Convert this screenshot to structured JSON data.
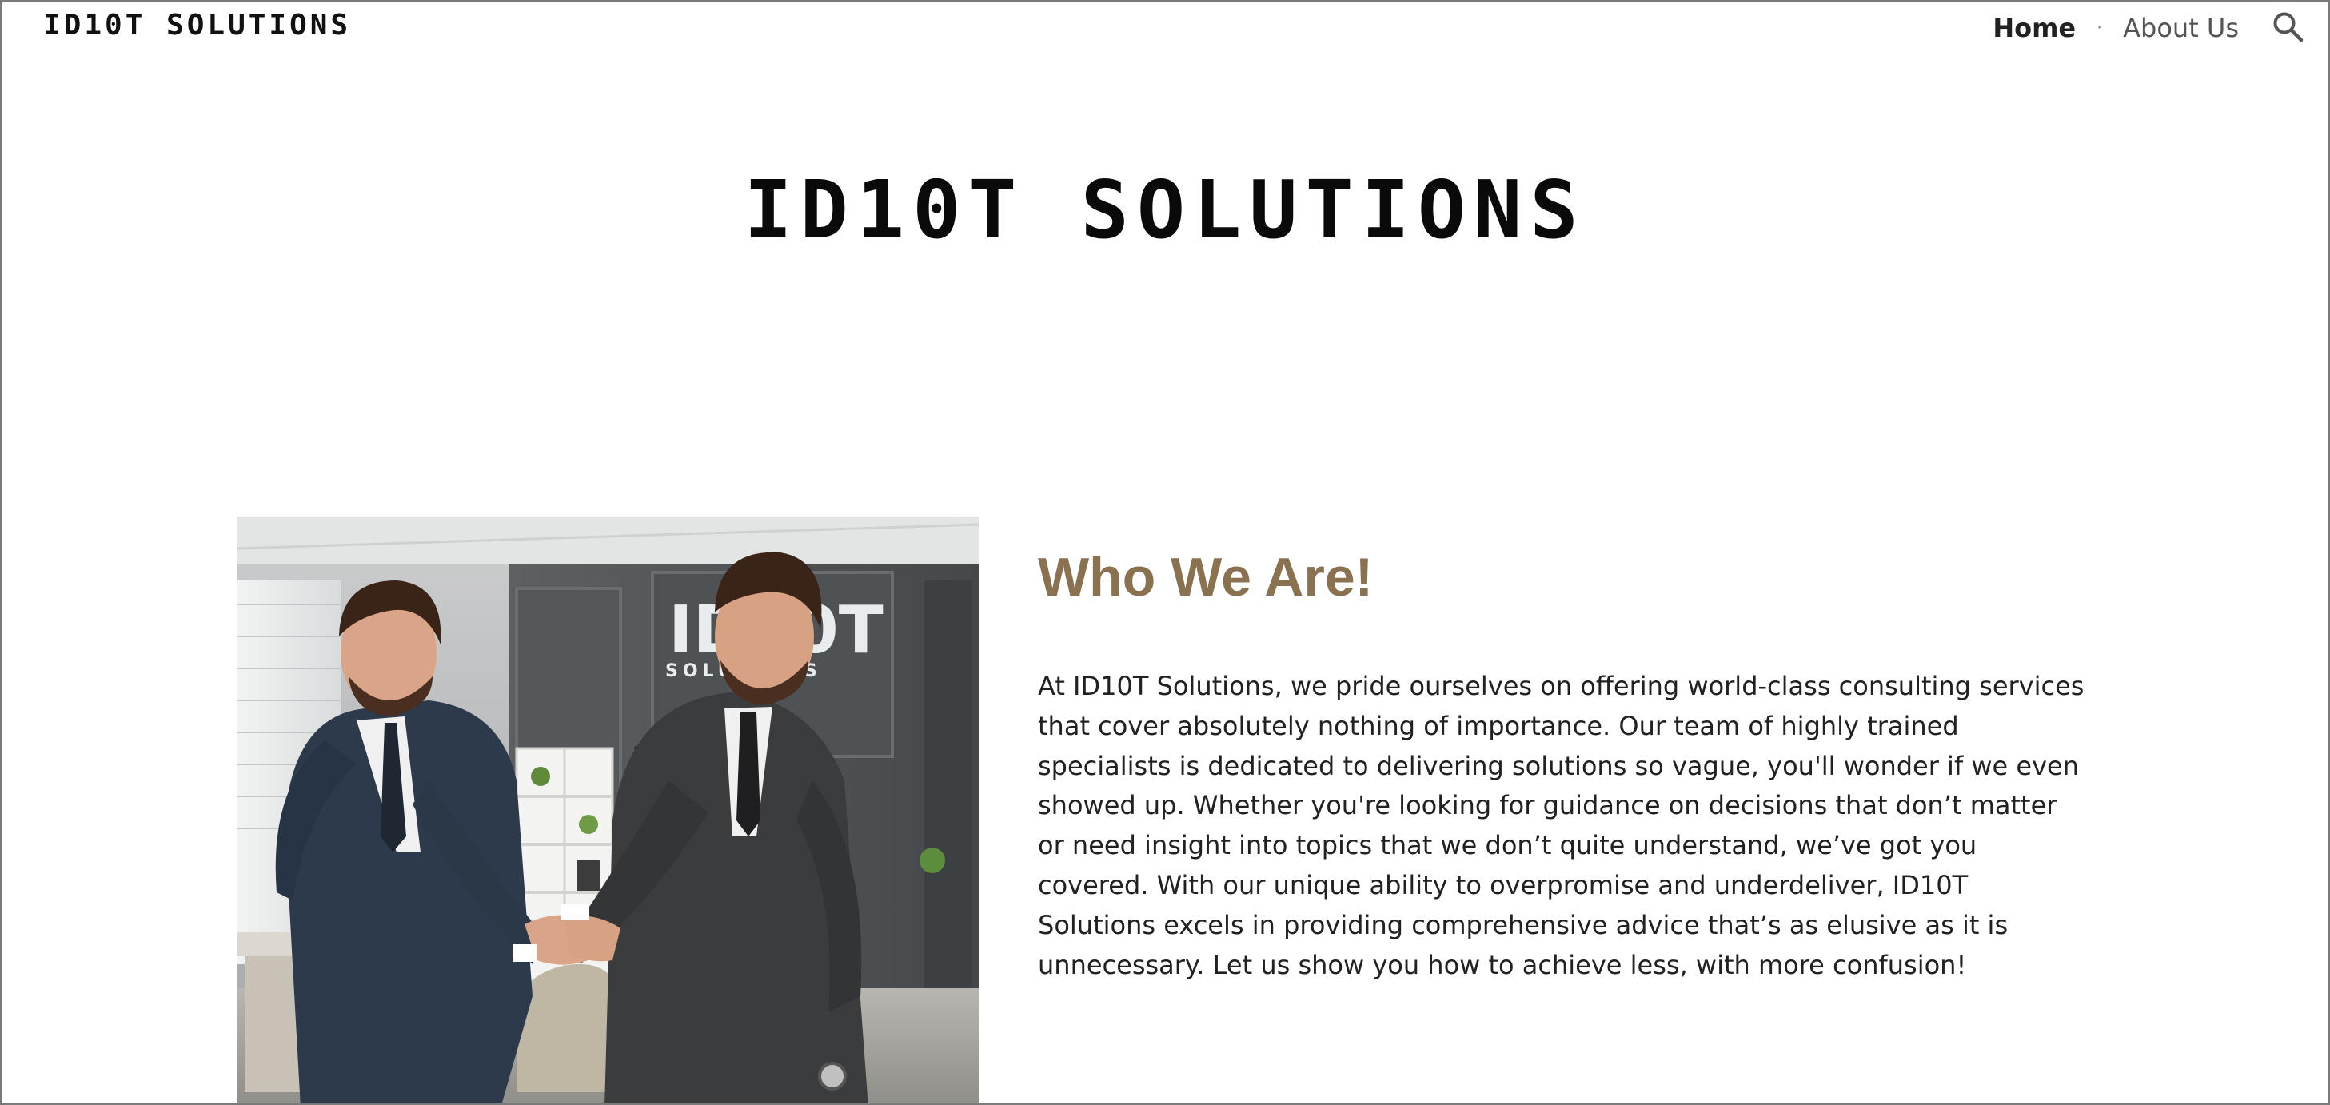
{
  "header": {
    "logo_text": "ID10T SOLUTIONS",
    "nav": [
      {
        "label": "Home",
        "active": true
      },
      {
        "label": "About Us",
        "active": false
      }
    ],
    "separator": "·",
    "search_icon": "search-icon"
  },
  "banner": {
    "logo_text": "ID10T SOLUTIONS"
  },
  "hero_image": {
    "icon": "business-handshake-photo",
    "wall_sign_line1": "ID10T",
    "wall_sign_line2": "SOLUTIONS"
  },
  "about": {
    "title": "Who We Are!",
    "body": "At ID10T Solutions, we pride ourselves on offering world-class consulting services that cover absolutely nothing of importance. Our team of highly trained specialists is dedicated to delivering solutions so vague, you'll wonder if we even showed up. Whether you're looking for guidance on decisions that don’t matter or need insight into topics that we don’t quite understand, we’ve got you covered. With our unique ability to overpromise and underdeliver, ID10T Solutions excels in providing comprehensive advice that’s as elusive as it is unnecessary. Let us show you how to achieve less, with more confusion!"
  },
  "colors": {
    "title": "#8a7150",
    "text": "#212121",
    "nav_inactive": "#555555",
    "frame_border": "#7a7a7a"
  }
}
